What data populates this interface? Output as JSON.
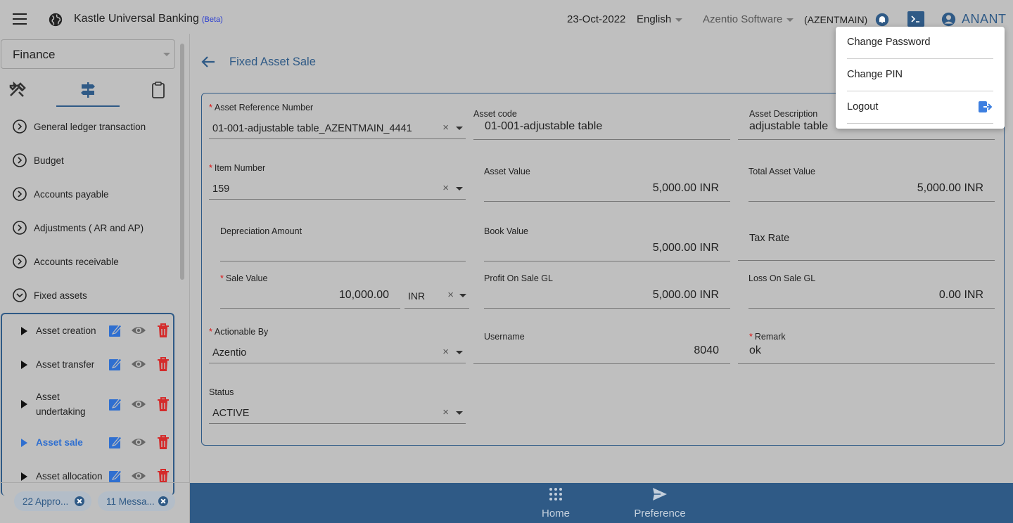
{
  "header": {
    "app_title": "Kastle Universal Banking",
    "beta_tag": "(Beta)",
    "date": "23-Oct-2022",
    "language": "English",
    "company": "Azentio Software",
    "branch": "(AZENTMAIN)",
    "user": "ANANT"
  },
  "sidebar": {
    "module": "Finance",
    "menu": [
      {
        "label": "General ledger transaction"
      },
      {
        "label": "Budget"
      },
      {
        "label": "Accounts payable"
      },
      {
        "label": "Adjustments ( AR and AP)"
      },
      {
        "label": "Accounts receivable"
      },
      {
        "label": "Fixed assets"
      }
    ],
    "submenu": [
      {
        "label": "Asset creation"
      },
      {
        "label": "Asset transfer"
      },
      {
        "label": "Asset undertaking"
      },
      {
        "label": "Asset sale"
      },
      {
        "label": "Asset allocation"
      }
    ],
    "chips": [
      {
        "label": "22 Appro..."
      },
      {
        "label": "11 Messa..."
      }
    ]
  },
  "page": {
    "title": "Fixed Asset Sale"
  },
  "form": {
    "asset_ref": {
      "label": "Asset Reference Number",
      "value": "01-001-adjustable table_AZENTMAIN_4441"
    },
    "asset_code": {
      "label": "Asset code",
      "value": "01-001-adjustable table"
    },
    "asset_desc": {
      "label": "Asset Description",
      "value": "adjustable table"
    },
    "item_number": {
      "label": "Item Number",
      "value": "159"
    },
    "asset_value": {
      "label": "Asset Value",
      "value": "5,000.00 INR"
    },
    "total_asset_value": {
      "label": "Total Asset Value",
      "value": "5,000.00 INR"
    },
    "depreciation_amount": {
      "label": "Depreciation Amount",
      "value": ""
    },
    "book_value": {
      "label": "Book Value",
      "value": "5,000.00 INR"
    },
    "tax_rate": {
      "label": "Tax Rate",
      "value": ""
    },
    "sale_value": {
      "label": "Sale Value",
      "value": "10,000.00",
      "currency": "INR"
    },
    "profit_gl": {
      "label": "Profit On Sale GL",
      "value": "5,000.00 INR"
    },
    "loss_gl": {
      "label": "Loss On Sale GL",
      "value": "0.00 INR"
    },
    "actionable_by": {
      "label": "Actionable By",
      "value": "Azentio"
    },
    "username": {
      "label": "Username",
      "value": "8040"
    },
    "remark": {
      "label": "Remark",
      "value": "ok"
    },
    "status": {
      "label": "Status",
      "value": "ACTIVE"
    }
  },
  "user_menu": {
    "change_password": "Change Password",
    "change_pin": "Change PIN",
    "logout": "Logout"
  },
  "bottom_nav": {
    "home": "Home",
    "preference": "Preference"
  },
  "colors": {
    "primary": "#2f5a86",
    "overlay_bg": "#bfbfbf",
    "required": "#dd1111",
    "delete": "#d42b2b",
    "edit": "#2f6fd0"
  }
}
